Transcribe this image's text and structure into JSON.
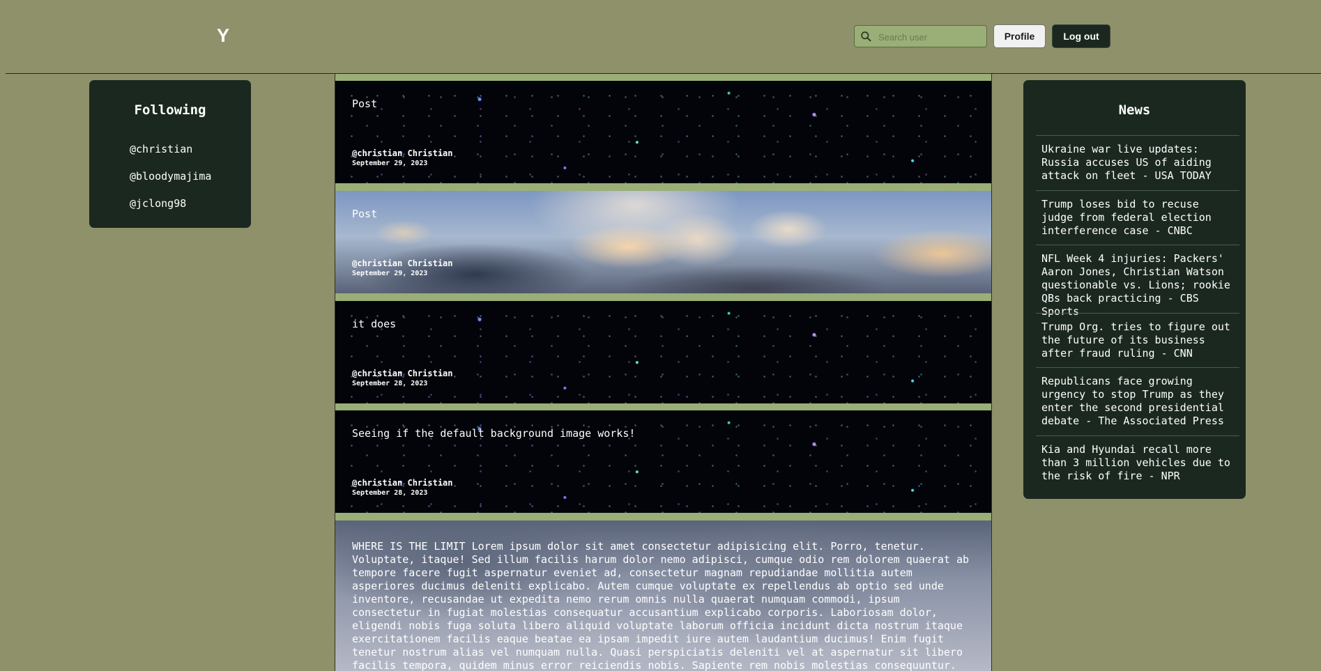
{
  "header": {
    "logo": "Y",
    "search_placeholder": "Search user",
    "profile_label": "Profile",
    "logout_label": "Log out"
  },
  "following": {
    "title": "Following",
    "users": [
      "@christian",
      "@bloodymajima",
      "@jclong98"
    ]
  },
  "feed": {
    "posts": [
      {
        "text": "Post",
        "author": "@christian Christian",
        "date": "September 29, 2023",
        "background": "stars"
      },
      {
        "text": "Post",
        "author": "@christian Christian",
        "date": "September 29, 2023",
        "background": "clouds"
      },
      {
        "text": "it does",
        "author": "@christian Christian",
        "date": "September 28, 2023",
        "background": "stars"
      },
      {
        "text": "Seeing if the default background image works!",
        "author": "@christian Christian",
        "date": "September 28, 2023",
        "background": "stars"
      },
      {
        "text": "WHERE IS THE LIMIT Lorem ipsum dolor sit amet consectetur adipisicing elit. Porro, tenetur. Voluptate, itaque! Sed illum facilis harum dolor nemo adipisci, cumque odio rem dolorem quaerat ab tempore facere fugit aspernatur eveniet ad, consectetur magnam repudiandae mollitia autem asperiores ducimus deleniti explicabo. Autem cumque voluptate ex repellendus ab optio sed unde inventore, recusandae ut expedita nemo rerum omnis nulla quaerat numquam commodi, ipsum consectetur in fugiat molestias consequatur accusantium explicabo corporis. Laboriosam dolor, eligendi nobis fuga soluta libero aliquid voluptate laborum officia incidunt dicta nostrum itaque exercitationem facilis eaque beatae ea ipsam impedit iure autem laudantium ducimus! Enim fugit tenetur nostrum alias vel numquam nulla. Quasi perspiciatis deleniti vel at aspernatur sit libero facilis tempora, quidem minus error reiciendis nobis. Sapiente rem nobis molestias consequuntur. Eum earum, quia sed ea similique",
        "background": "fog"
      }
    ]
  },
  "news": {
    "title": "News",
    "items": [
      "Ukraine war live updates: Russia accuses US of aiding attack on fleet - USA TODAY",
      "Trump loses bid to recuse judge from federal election interference case - CNBC",
      "NFL Week 4 injuries: Packers' Aaron Jones, Christian Watson questionable vs. Lions; rookie QBs back practicing - CBS Sports",
      "Trump Org. tries to figure out the future of its business after fraud ruling - CNN",
      "Republicans face growing urgency to stop Trump as they enter the second presidential debate - The Associated Press",
      "Kia and Hyundai recall more than 3 million vehicles due to the risk of fire - NPR"
    ]
  },
  "colors": {
    "page_bg": "#8f916b",
    "panel_bg": "#1b2820",
    "feed_gap": "#9aae78"
  },
  "icons": {
    "search": "search-icon"
  }
}
